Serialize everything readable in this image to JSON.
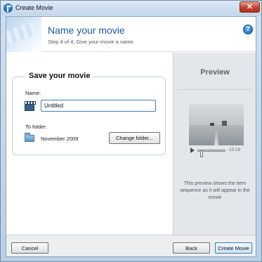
{
  "window": {
    "title": "Create Movie",
    "close_label": "✕"
  },
  "header": {
    "title": "Name your movie",
    "subtitle": "Step 4 of 4: Give your movie a name",
    "help_glyph": "?"
  },
  "save_group": {
    "title": "Save your movie",
    "name_label": "Name:",
    "name_value": "Untitled",
    "folder_label": "To folder:",
    "folder_value": "November 2009",
    "change_folder_label": "Change folder..."
  },
  "preview": {
    "title": "Preview",
    "time": "10:19",
    "seek_position": 0.1,
    "note": "This preview shows the item sequence as it will appear in the movie"
  },
  "footer": {
    "cancel_label": "Cancel",
    "back_label": "Back",
    "create_label": "Create Movie"
  },
  "colors": {
    "title_blue": "#1c5aa6",
    "preview_pane": "#e4e7ea",
    "close_red": "#c5402c"
  },
  "icons": {
    "app": "app-logo-icon",
    "help": "help-icon",
    "movie": "clapperboard-icon",
    "folder": "folder-icon",
    "play": "play-icon"
  }
}
